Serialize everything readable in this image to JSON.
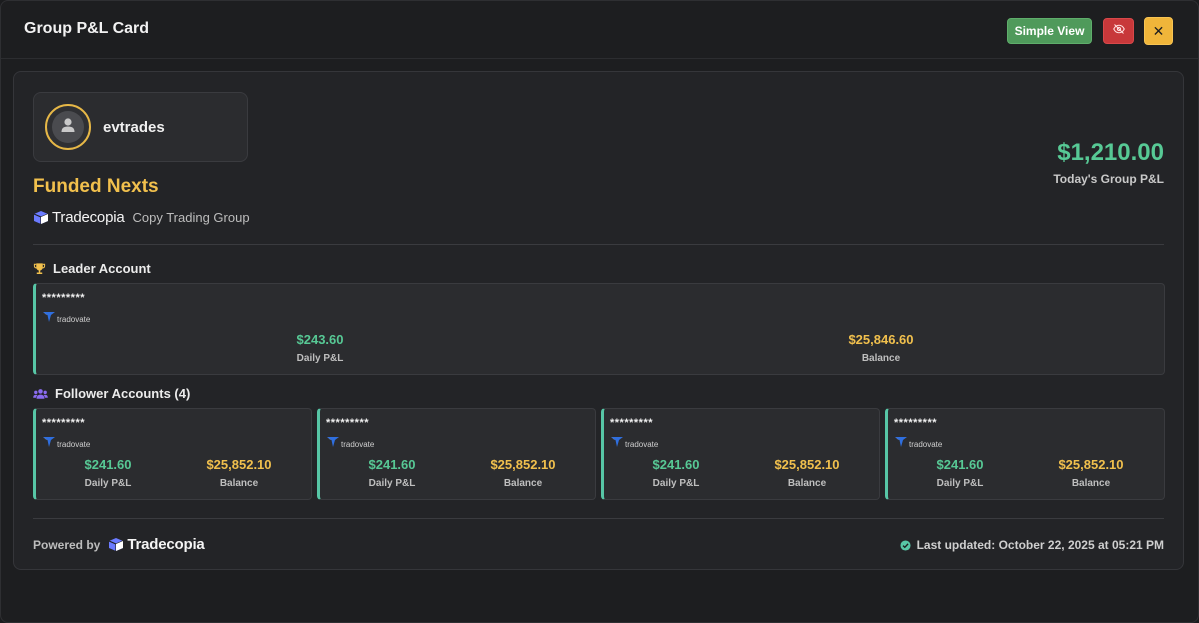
{
  "window": {
    "title": "Group P&L Card",
    "simple_view_label": "Simple View",
    "hide_icon": "eye-slash-icon",
    "close_label": "✕"
  },
  "profile": {
    "username": "evtrades",
    "avatar_icon": "user-icon"
  },
  "group": {
    "name": "Funded Nexts",
    "brand": "Tradecopia",
    "subtitle": "Copy Trading Group"
  },
  "total": {
    "value": "$1,210.00",
    "label": "Today's Group P&L"
  },
  "leader": {
    "heading": "Leader Account",
    "icon": "trophy-icon",
    "account": {
      "masked_id": "*********",
      "broker": "tradovate",
      "daily_pnl": "$243.60",
      "daily_pnl_label": "Daily P&L",
      "balance": "$25,846.60",
      "balance_label": "Balance"
    }
  },
  "followers": {
    "heading": "Follower Accounts (4)",
    "icon": "users-icon",
    "accounts": [
      {
        "masked_id": "*********",
        "broker": "tradovate",
        "daily_pnl": "$241.60",
        "daily_pnl_label": "Daily P&L",
        "balance": "$25,852.10",
        "balance_label": "Balance"
      },
      {
        "masked_id": "*********",
        "broker": "tradovate",
        "daily_pnl": "$241.60",
        "daily_pnl_label": "Daily P&L",
        "balance": "$25,852.10",
        "balance_label": "Balance"
      },
      {
        "masked_id": "*********",
        "broker": "tradovate",
        "daily_pnl": "$241.60",
        "daily_pnl_label": "Daily P&L",
        "balance": "$25,852.10",
        "balance_label": "Balance"
      },
      {
        "masked_id": "*********",
        "broker": "tradovate",
        "daily_pnl": "$241.60",
        "daily_pnl_label": "Daily P&L",
        "balance": "$25,852.10",
        "balance_label": "Balance"
      }
    ]
  },
  "footer": {
    "powered_by": "Powered by",
    "brand": "Tradecopia",
    "last_updated": "Last updated: October 22, 2025 at 05:21 PM",
    "status_icon": "check-circle-icon"
  },
  "colors": {
    "green": "#57c995",
    "yellow": "#f1c04d",
    "accent_border": "#57c6a6",
    "simple_view_bg": "#4f9a5b",
    "hide_bg": "#c8383a",
    "close_bg": "#f0b53a"
  }
}
